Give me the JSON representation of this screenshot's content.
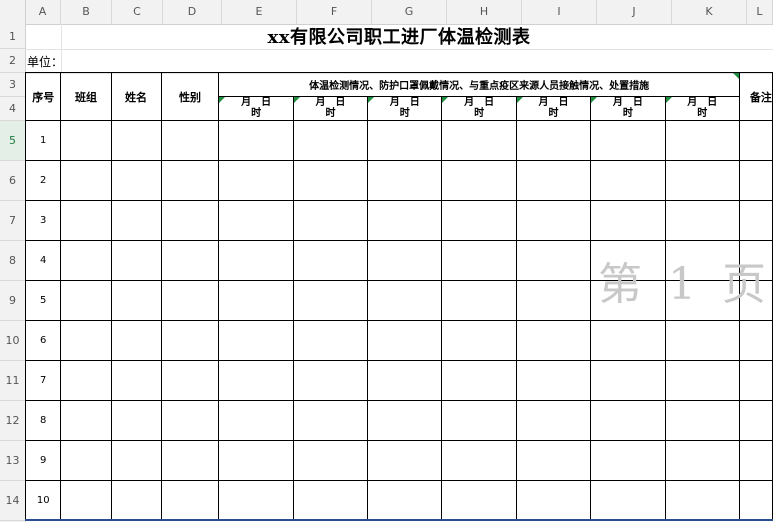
{
  "columns": [
    "A",
    "B",
    "C",
    "D",
    "E",
    "F",
    "G",
    "H",
    "I",
    "J",
    "K",
    "L"
  ],
  "rows": [
    "1",
    "2",
    "3",
    "4",
    "5",
    "6",
    "7",
    "8",
    "9",
    "10",
    "11",
    "12",
    "13",
    "14"
  ],
  "active_row": "5",
  "sheet": {
    "title": "xx有限公司职工进厂体温检测表",
    "unit_label": "单位：",
    "headers": {
      "seq": "序号",
      "team": "班组",
      "name": "姓名",
      "gender": "性别",
      "group": "体温检测情况、防护口罩佩戴情况、与重点疫区来源人员接触情况、处置措施",
      "remarks": "备注"
    },
    "date_label_top": "月　日",
    "date_label_bottom": "时",
    "date_columns": 7,
    "row_numbers": [
      "1",
      "2",
      "3",
      "4",
      "5",
      "6",
      "7",
      "8",
      "9",
      "10"
    ]
  },
  "watermark": "第 1 页",
  "colors": {
    "accent_green": "#1f8f3f",
    "watermark": "#c8c8c8",
    "frame_blue": "#2a4f8f"
  }
}
